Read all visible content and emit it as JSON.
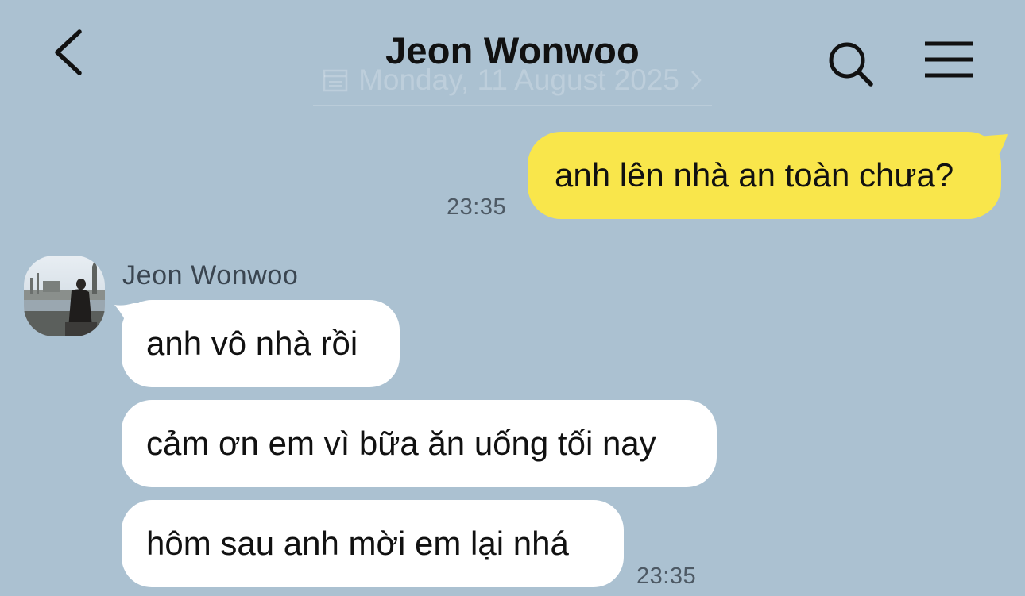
{
  "header": {
    "title": "Jeon Wonwoo",
    "date_banner": "Monday, 11 August 2025"
  },
  "icons": {
    "back": "chevron-left-icon",
    "search": "search-icon",
    "menu": "hamburger-menu-icon",
    "calendar": "calendar-icon"
  },
  "colors": {
    "background": "#abc1d1",
    "outgoing_bubble": "#f9e64b",
    "incoming_bubble": "#ffffff"
  },
  "messages": {
    "outgoing": [
      {
        "text": "anh lên nhà an toàn chưa?",
        "time": "23:35"
      }
    ],
    "incoming": {
      "sender": "Jeon Wonwoo",
      "items": [
        {
          "text": "anh vô nhà rồi"
        },
        {
          "text": "cảm ơn em vì bữa ăn uống tối nay"
        },
        {
          "text": "hôm sau anh mời em lại nhá"
        }
      ],
      "time": "23:35"
    }
  }
}
